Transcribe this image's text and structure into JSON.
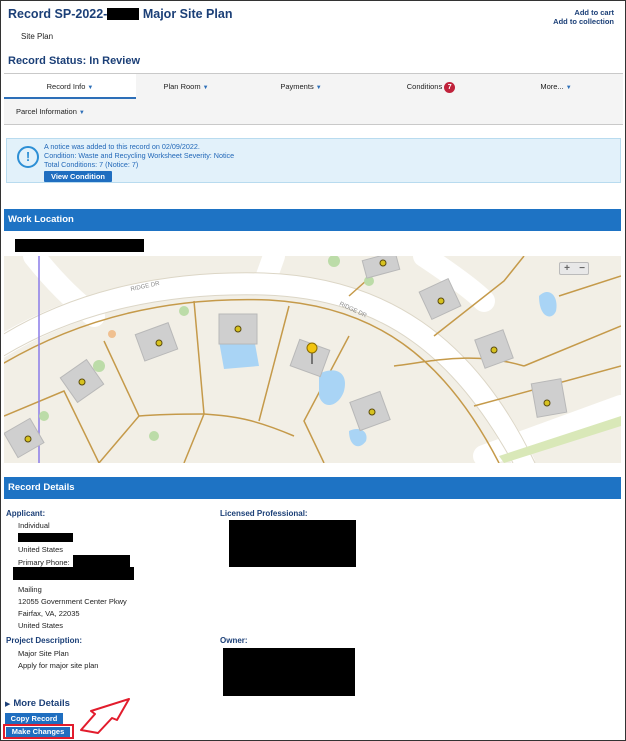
{
  "header": {
    "record_prefix": "Record SP-2022-",
    "record_suffix": "Major Site Plan",
    "add_to_cart": "Add to cart",
    "add_to_collection": "Add to collection",
    "record_type": "Site Plan",
    "status": "Record Status: In Review"
  },
  "tabs": {
    "record_info": "Record Info",
    "plan_room": "Plan Room",
    "payments": "Payments",
    "conditions": "Conditions",
    "conditions_count": "7",
    "more": "More...",
    "parcel_information": "Parcel Information"
  },
  "notice": {
    "line1": "A notice was added to this record on 02/09/2022.",
    "line2": "Condition: Waste and Recycling Worksheet   Severity: Notice",
    "line3": "Total Conditions: 7  (Notice: 7)",
    "button": "View Condition"
  },
  "work_location": {
    "title": "Work Location",
    "map_labels": [
      "RIDGE DR",
      "RIDGE DR"
    ],
    "zoom_in": "+",
    "zoom_out": "−"
  },
  "record_details": {
    "title": "Record Details",
    "applicant_label": "Applicant:",
    "applicant_type": "Individual",
    "applicant_country": "United States",
    "primary_phone_label": "Primary Phone:",
    "mailing_label": "Mailing",
    "mailing_street": "12055 Government Center Pkwy",
    "mailing_city": "Fairfax, VA, 22035",
    "mailing_country": "United States",
    "licensed_professional_label": "Licensed Professional:",
    "project_description_label": "Project Description:",
    "project_line1": "Major Site Plan",
    "project_line2": "Apply for major site plan",
    "owner_label": "Owner:"
  },
  "actions": {
    "more_details": "More Details",
    "copy_record": "Copy Record",
    "make_changes": "Make Changes"
  },
  "colors": {
    "brand_blue": "#1e73c4",
    "title_navy": "#1b3f77",
    "badge_red": "#c0223b",
    "highlight_red": "#e21c2c"
  }
}
